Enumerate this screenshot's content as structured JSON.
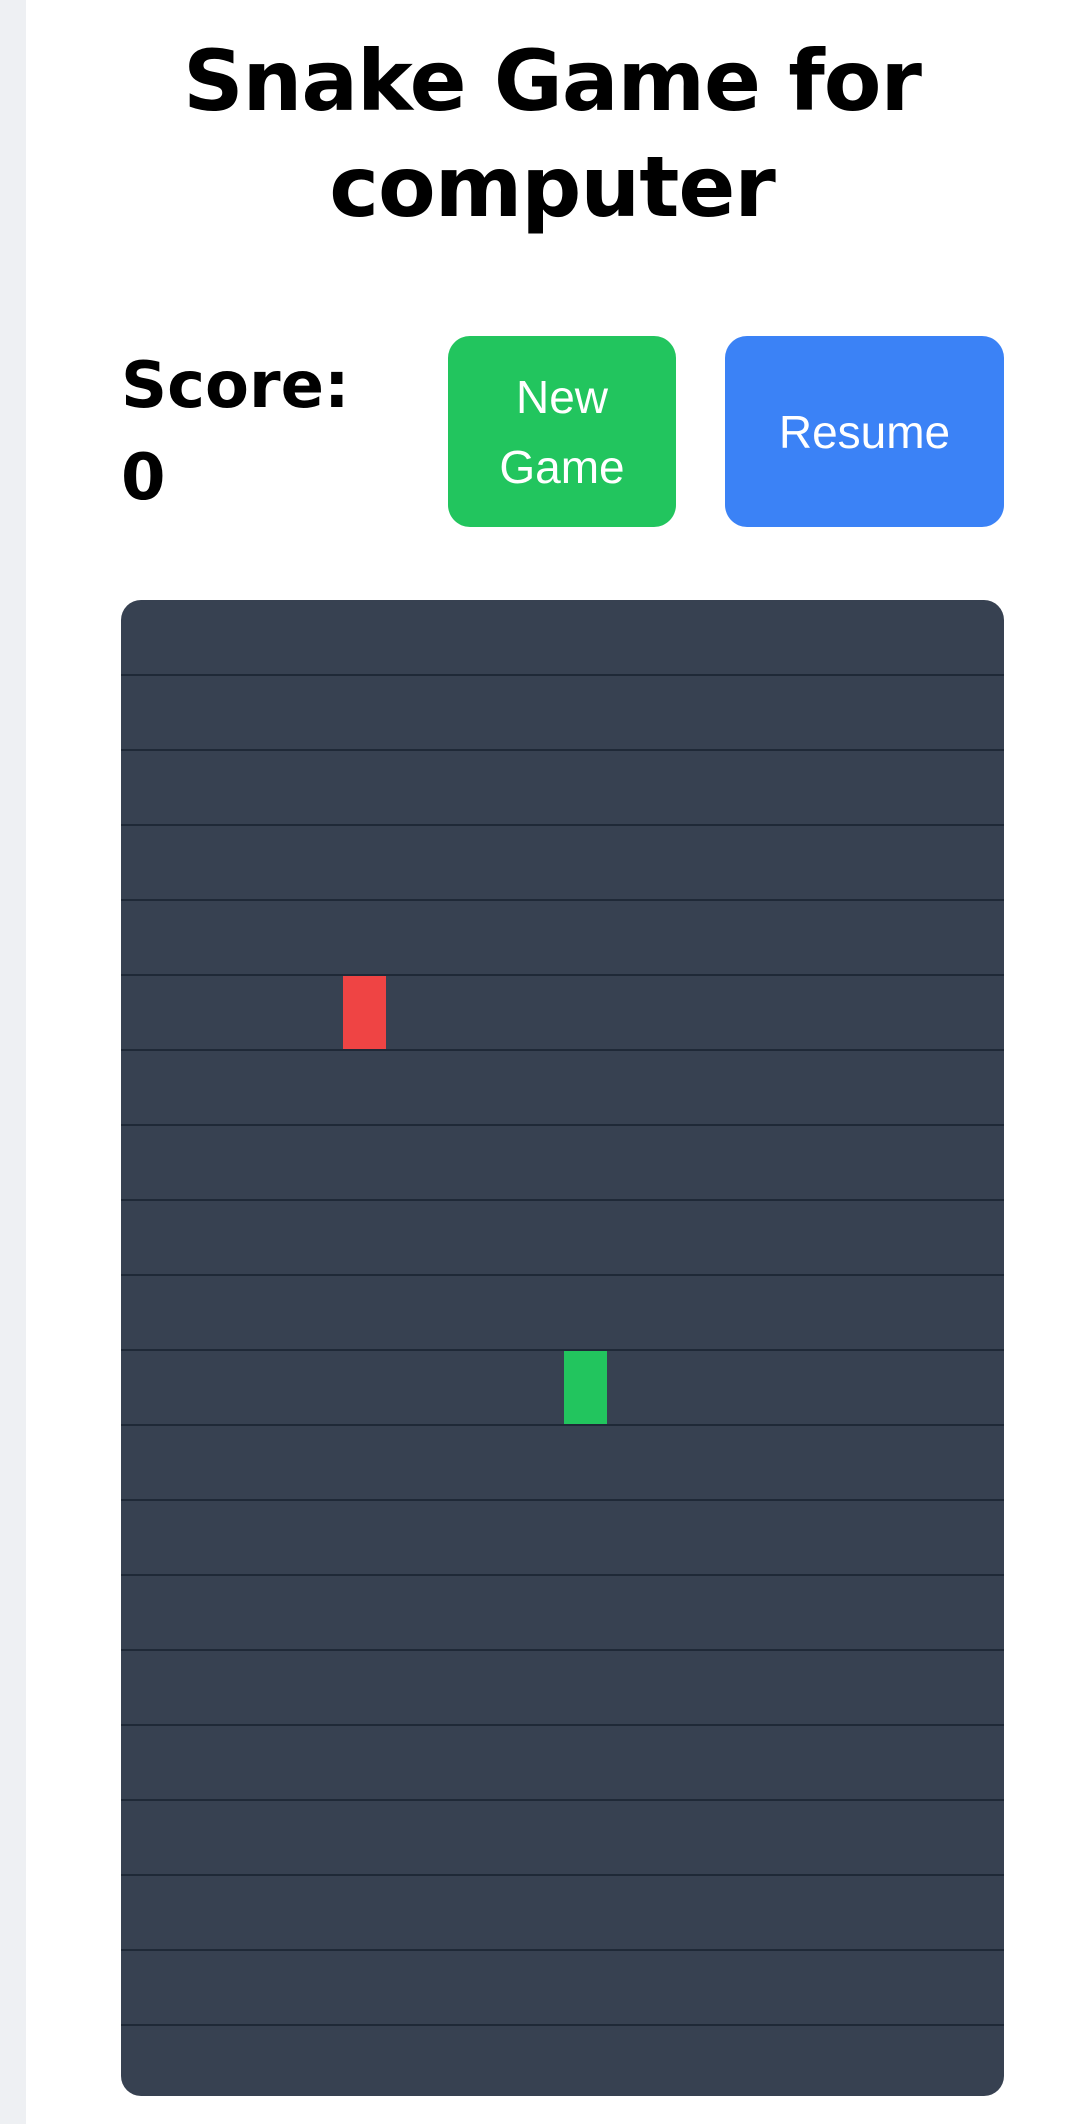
{
  "title": "Snake Game for computer",
  "score": {
    "label": "Score:",
    "value": "0"
  },
  "buttons": {
    "new_game": "New Game",
    "resume": "Resume"
  },
  "board": {
    "rows": 20,
    "cols": 20,
    "food": {
      "row": 5,
      "col": 5
    },
    "snake": [
      {
        "row": 10,
        "col": 10
      }
    ]
  },
  "colors": {
    "board_bg": "#374151",
    "grid_line": "#1f2937",
    "snake": "#22c55e",
    "food": "#ef4444",
    "new_game_button": "#22c55e",
    "resume_button": "#3b82f6"
  }
}
